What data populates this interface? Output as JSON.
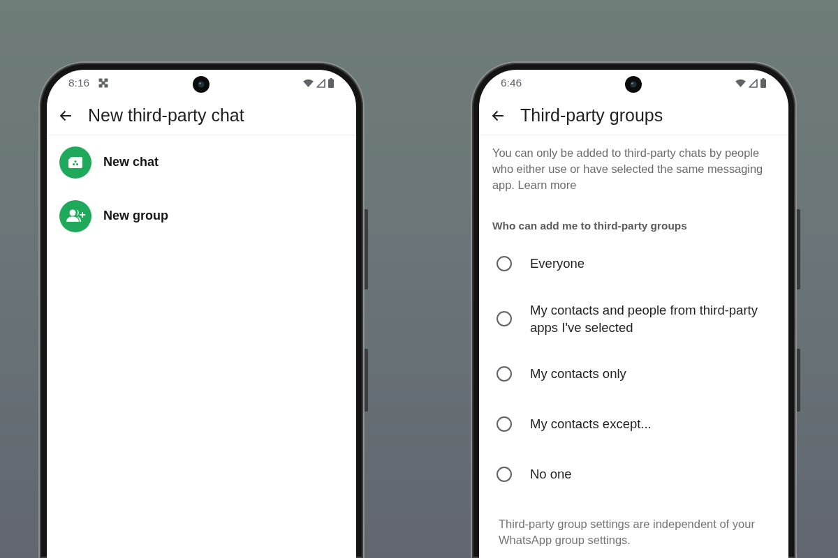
{
  "phones": [
    {
      "kind": "menu",
      "status_bar": {
        "time": "8:16",
        "notification_icon": true
      },
      "title": "New third-party chat",
      "items": [
        {
          "kind": "chat",
          "label": "New chat"
        },
        {
          "kind": "group",
          "label": "New group"
        }
      ]
    },
    {
      "kind": "settings",
      "status_bar": {
        "time": "6:46",
        "notification_icon": false
      },
      "title": "Third-party groups",
      "description": "You can only be added to third-party chats by people who either use or have selected the same messaging app.",
      "link": "Learn more",
      "section_title": "Who can add me to third-party groups",
      "options": [
        {
          "label": "Everyone",
          "selected": false
        },
        {
          "label": "My contacts and people from third-party apps I've selected",
          "selected": false
        },
        {
          "label": "My contacts only",
          "selected": false
        },
        {
          "label": "My contacts except...",
          "selected": false
        },
        {
          "label": "No one",
          "selected": false
        }
      ],
      "footnote": "Third-party group settings are independent of your WhatsApp group settings."
    }
  ]
}
